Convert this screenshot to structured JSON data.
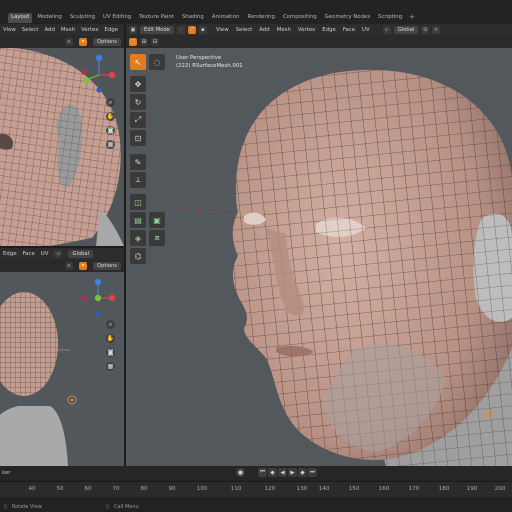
{
  "workspaces": {
    "tabs": [
      "Layout",
      "Modeling",
      "Sculpting",
      "UV Editing",
      "Texture Paint",
      "Shading",
      "Animation",
      "Rendering",
      "Compositing",
      "Geometry Nodes",
      "Scripting"
    ],
    "active": "Layout",
    "add_label": "+"
  },
  "left_top_header": {
    "menus": [
      "View",
      "Select",
      "Add",
      "Mesh",
      "Vertex",
      "Edge"
    ],
    "options_label": "Options"
  },
  "main_header": {
    "mode_label": "Edit Mode",
    "menus": [
      "View",
      "Select",
      "Add",
      "Mesh",
      "Vertex",
      "Edge",
      "Face",
      "UV"
    ],
    "orientation_label": "Global"
  },
  "left_bottom_header": {
    "menus": [
      "Edge",
      "Face",
      "UV"
    ],
    "orientation_label": "Global",
    "options_label": "Options"
  },
  "main_viewport": {
    "view_name": "User Perspective",
    "object_info": "(222) RSurfaceMesh.001"
  },
  "timeline": {
    "ruler_ticks": [
      "40",
      "50",
      "60",
      "70",
      "80",
      "90",
      "100",
      "110",
      "120",
      "130",
      "140",
      "150",
      "160",
      "170",
      "180",
      "190",
      "200"
    ],
    "left_label": "ker"
  },
  "status_bar": {
    "rotate_view": "Rotate View",
    "call_menu": "Call Menu"
  },
  "colors": {
    "accent": "#e07d1e",
    "viewport_bg": "#51575b",
    "skin": "#c8a598",
    "axis_x": "#e04050",
    "axis_y": "#7fc13a",
    "axis_z": "#3f7fe5"
  }
}
